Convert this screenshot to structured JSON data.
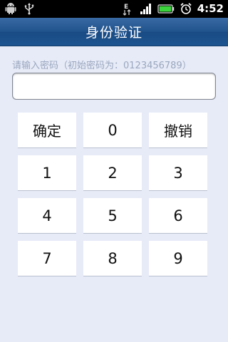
{
  "status_bar": {
    "time": "4:52",
    "icons_left": [
      "android-debug-icon",
      "usb-icon"
    ],
    "icons_right": [
      "edge-network-icon",
      "signal-icon",
      "battery-icon",
      "alarm-icon"
    ],
    "network_label": "E"
  },
  "title_bar": {
    "title": "身份验证"
  },
  "password": {
    "prompt": "请输入密码（初始密码为：0123456789）",
    "value": "",
    "placeholder": ""
  },
  "keypad": {
    "keys": [
      "确定",
      "0",
      "撤销",
      "1",
      "2",
      "3",
      "4",
      "5",
      "6",
      "7",
      "8",
      "9"
    ]
  },
  "colors": {
    "background": "#e7ebf7",
    "title_bar": "#20528c",
    "status_bar": "#000000",
    "key_background": "#ffffff",
    "prompt_text": "#9aa7bf"
  }
}
